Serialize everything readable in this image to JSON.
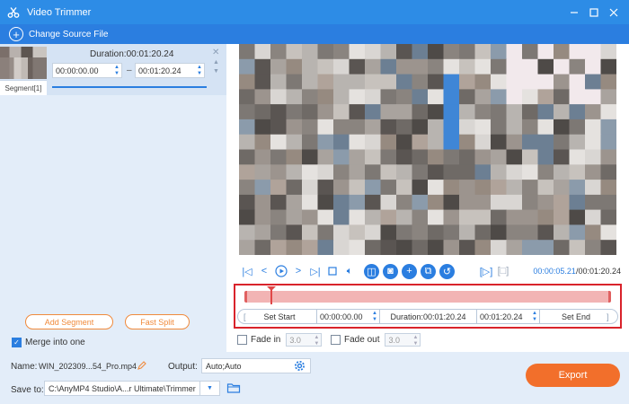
{
  "window": {
    "title": "Video Trimmer",
    "icons": [
      "scissors-icon",
      "minimize-icon",
      "maximize-icon",
      "close-icon"
    ]
  },
  "toolbar": {
    "change_source_label": "Change Source File"
  },
  "segment": {
    "tab_label": "Segment[1]",
    "duration_label": "Duration:00:01:20.24",
    "start_time": "00:00:00.00",
    "end_time": "00:01:20.24",
    "dash": "–"
  },
  "left_actions": {
    "add_segment_label": "Add Segment",
    "fast_split_label": "Fast Split",
    "merge_label": "Merge into one",
    "merge_checked": true
  },
  "player": {
    "current_time": "00:00:05.21",
    "separator": "/",
    "total_time": "00:01:20.24",
    "progress_fraction": 0.065
  },
  "trim": {
    "set_start_label": "Set Start",
    "start_value": "00:00:00.00",
    "duration_label": "Duration:00:01:20.24",
    "end_value": "00:01:20.24",
    "set_end_label": "Set End"
  },
  "fades": {
    "fade_in_label": "Fade in",
    "fade_in_value": "3.0",
    "fade_out_label": "Fade out",
    "fade_out_value": "3.0"
  },
  "output": {
    "name_label": "Name:",
    "name_value": "WIN_202309...54_Pro.mp4",
    "output_label": "Output:",
    "output_value": "Auto;Auto",
    "save_to_label": "Save to:",
    "save_to_value": "C:\\AnyMP4 Studio\\A...r Ultimate\\Trimmer",
    "export_label": "Export"
  },
  "colors": {
    "accent": "#2b7ee0",
    "export": "#f26f2b",
    "trim_highlight": "#d9232b"
  }
}
